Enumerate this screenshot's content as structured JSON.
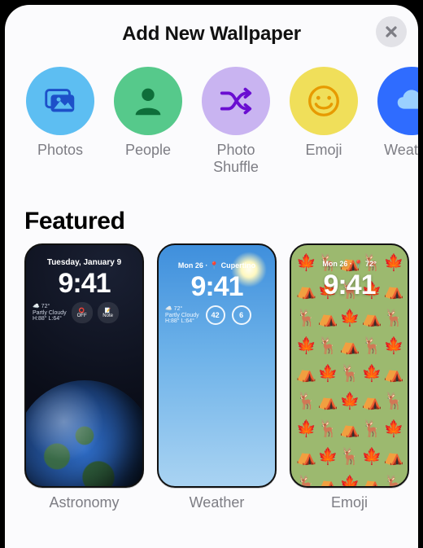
{
  "header": {
    "title": "Add New Wallpaper",
    "close_icon": "close-icon"
  },
  "categories": [
    {
      "id": "photos",
      "label": "Photos",
      "bg": "#5dbef2",
      "icon": "photos-icon",
      "fg": "#1d50c9"
    },
    {
      "id": "people",
      "label": "People",
      "bg": "#56c98b",
      "icon": "person-icon",
      "fg": "#0e6e3a"
    },
    {
      "id": "shuffle",
      "label": "Photo Shuffle",
      "bg": "#c9b4f1",
      "icon": "shuffle-icon",
      "fg": "#6a0ed1"
    },
    {
      "id": "emoji",
      "label": "Emoji",
      "bg": "#f0df5a",
      "icon": "smiley-icon",
      "fg": "#e79a00"
    },
    {
      "id": "weather",
      "label": "Weather",
      "bg": "#2f6cff",
      "icon": "cloud-icon",
      "fg": "#9bd0ff"
    }
  ],
  "section": {
    "featured": "Featured"
  },
  "featured": [
    {
      "id": "astronomy",
      "label": "Astronomy",
      "date": "Tuesday, January 9",
      "time": "9:41",
      "weather": {
        "temp": "72°",
        "cond": "Partly Cloudy",
        "hilo": "H:88° L:64°"
      },
      "widget_a": "OFF",
      "widget_b": "Note"
    },
    {
      "id": "weather",
      "label": "Weather",
      "date": "Mon 26 · 📍 Cupertino",
      "time": "9:41",
      "weather": {
        "temp": "72°",
        "cond": "Partly Cloudy",
        "hilo": "H:88° L:64°"
      },
      "ring_a": "42",
      "ring_b": "6"
    },
    {
      "id": "emoji",
      "label": "Emoji",
      "date": "Mon 26 · 📍 72°",
      "time": "9:41",
      "pattern": [
        "🍁",
        "🦌",
        "⛺",
        "🦌",
        "🍁",
        "⛺",
        "🍁",
        "🦌",
        "🍁",
        "⛺",
        "🦌",
        "⛺",
        "🍁",
        "⛺",
        "🦌",
        "🍁",
        "🦌",
        "⛺",
        "🦌",
        "🍁",
        "⛺",
        "🍁",
        "🦌",
        "🍁",
        "⛺",
        "🦌",
        "⛺",
        "🍁",
        "⛺",
        "🦌",
        "🍁",
        "🦌",
        "⛺",
        "🦌",
        "🍁",
        "⛺",
        "🍁",
        "🦌",
        "🍁",
        "⛺",
        "🦌",
        "⛺",
        "🍁",
        "⛺",
        "🦌"
      ]
    }
  ]
}
